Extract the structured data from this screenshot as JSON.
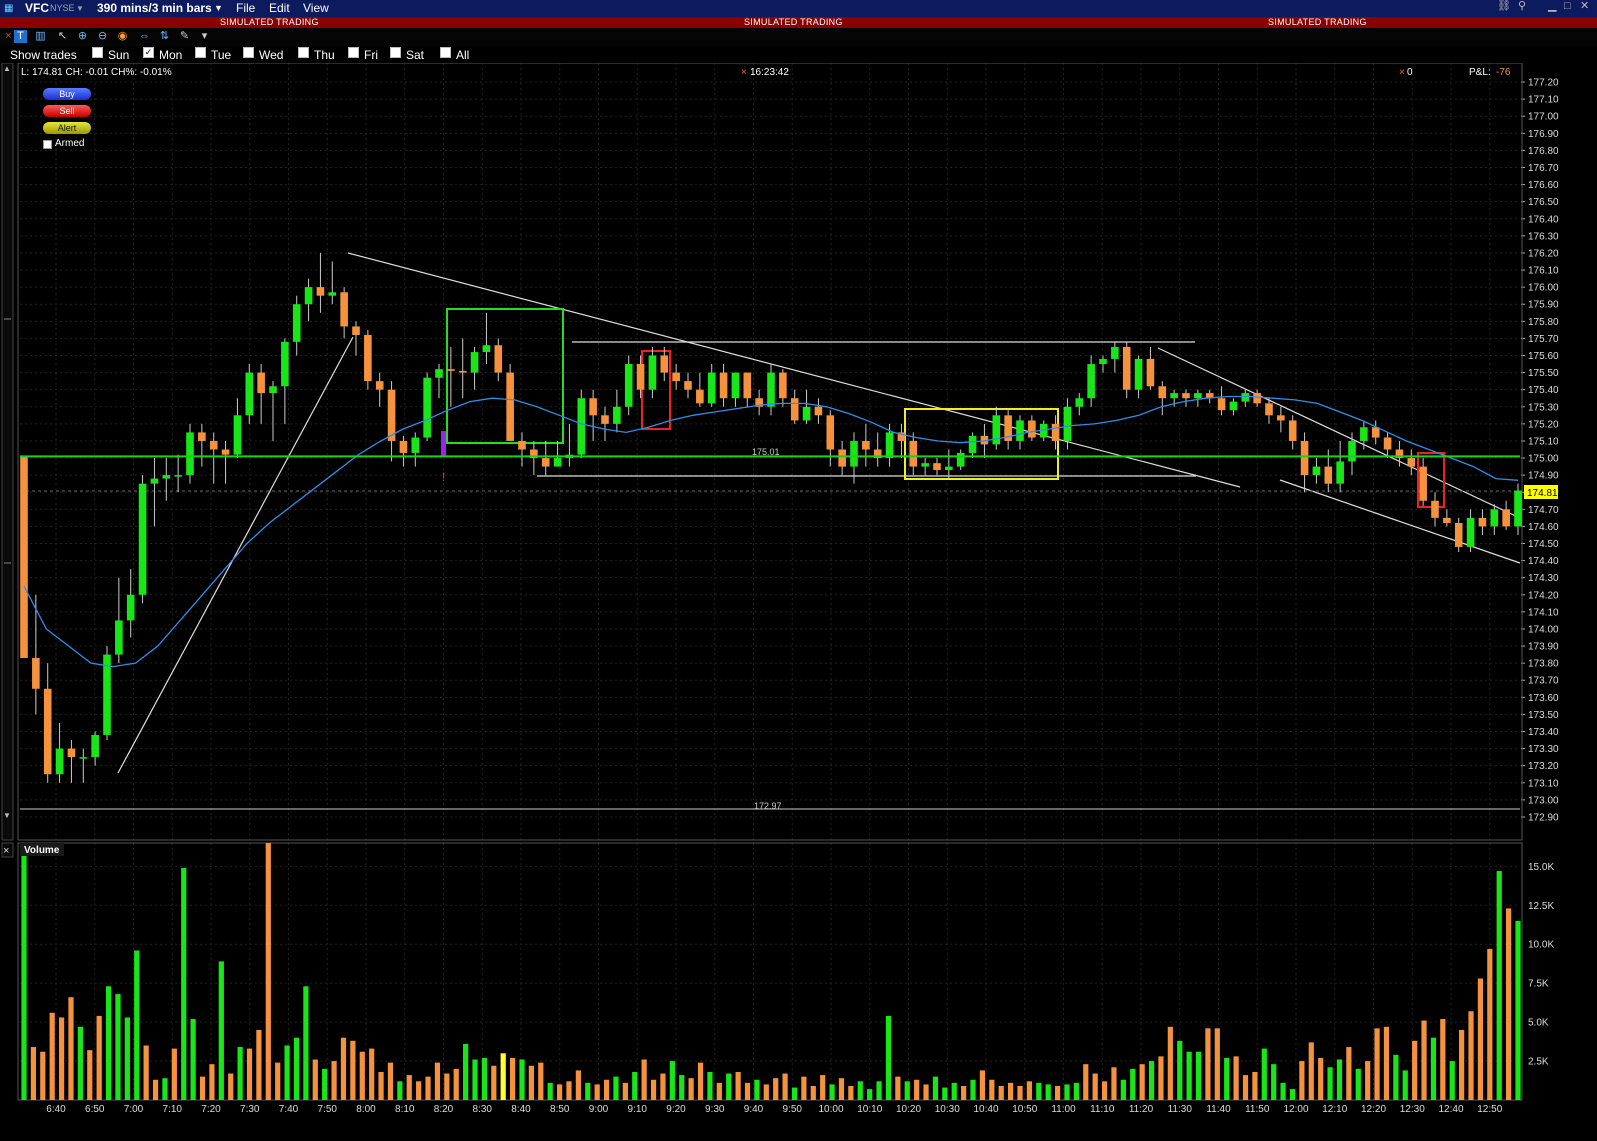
{
  "menubar": {
    "symbol": "VFC",
    "exchange": "NYSE",
    "timeframe": "390 mins/3 min bars",
    "menu_file": "File",
    "menu_edit": "Edit",
    "menu_view": "View"
  },
  "banner": {
    "text_left": "SIMULATED TRADING",
    "text_center": "SIMULATED TRADING",
    "text_right": "SIMULATED TRADING"
  },
  "days": {
    "show_trades": "Show trades",
    "items": [
      {
        "label": "Sun",
        "checked": false
      },
      {
        "label": "Mon",
        "checked": true
      },
      {
        "label": "Tue",
        "checked": false
      },
      {
        "label": "Wed",
        "checked": false
      },
      {
        "label": "Thu",
        "checked": false
      },
      {
        "label": "Fri",
        "checked": false
      },
      {
        "label": "Sat",
        "checked": false
      },
      {
        "label": "All",
        "checked": false
      }
    ]
  },
  "info": {
    "stats": "L: 174.81  CH: -0.01  CH%: -0.01%",
    "time": "16:23:42",
    "position": "0",
    "pnl_label": "P&L:",
    "pnl_value": "-76"
  },
  "order_buttons": {
    "buy": "Buy",
    "sell": "Sell",
    "alert": "Alert",
    "armed": "Armed"
  },
  "price_labels": {
    "last": "174.81",
    "level_line": "175.01",
    "low_label": "172.97"
  },
  "volume_title": "Volume",
  "colors": {
    "up": "#19e619",
    "down": "#f5923e",
    "doji": "#ffff33",
    "ema": "#2f8fe8",
    "level": "#19d219"
  },
  "chart_data": [
    {
      "type": "candlestick",
      "ylim": [
        172.85,
        177.25
      ],
      "yticks": [
        "177.20",
        "177.10",
        "177.00",
        "176.90",
        "176.80",
        "176.70",
        "176.60",
        "176.50",
        "176.40",
        "176.30",
        "176.20",
        "176.10",
        "176.00",
        "175.90",
        "175.80",
        "175.70",
        "175.60",
        "175.50",
        "175.40",
        "175.30",
        "175.20",
        "175.10",
        "175.00",
        "174.90",
        "174.80",
        "174.70",
        "174.60",
        "174.50",
        "174.40",
        "174.30",
        "174.20",
        "174.10",
        "174.00",
        "173.90",
        "173.80",
        "173.70",
        "173.60",
        "173.50",
        "173.40",
        "173.30",
        "173.20",
        "173.10",
        "173.00",
        "172.90"
      ],
      "xticks": [
        "6:40",
        "6:50",
        "7:00",
        "7:10",
        "7:20",
        "7:30",
        "7:40",
        "7:50",
        "8:00",
        "8:10",
        "8:20",
        "8:30",
        "8:40",
        "8:50",
        "9:00",
        "9:10",
        "9:20",
        "9:30",
        "9:40",
        "9:50",
        "10:00",
        "10:10",
        "10:20",
        "10:30",
        "10:40",
        "10:50",
        "11:00",
        "11:10",
        "11:20",
        "11:30",
        "11:40",
        "11:50",
        "12:00",
        "12:10",
        "12:20",
        "12:30",
        "12:40",
        "12:50"
      ],
      "candles": [
        [
          175.01,
          175.01,
          173.83,
          173.83
        ],
        [
          173.83,
          174.2,
          173.5,
          173.65
        ],
        [
          173.65,
          173.8,
          173.1,
          173.15
        ],
        [
          173.15,
          173.45,
          173.1,
          173.3
        ],
        [
          173.3,
          173.35,
          173.1,
          173.25
        ],
        [
          173.25,
          173.3,
          173.1,
          173.25
        ],
        [
          173.25,
          173.4,
          173.2,
          173.38
        ],
        [
          173.38,
          173.9,
          173.35,
          173.85
        ],
        [
          173.85,
          174.3,
          173.8,
          174.05
        ],
        [
          174.05,
          174.35,
          173.95,
          174.2
        ],
        [
          174.2,
          174.9,
          174.15,
          174.85
        ],
        [
          174.85,
          175.0,
          174.6,
          174.88
        ],
        [
          174.88,
          175.0,
          174.75,
          174.9
        ],
        [
          174.9,
          175.02,
          174.8,
          174.9
        ],
        [
          174.9,
          175.2,
          174.85,
          175.15
        ],
        [
          175.15,
          175.2,
          174.95,
          175.1
        ],
        [
          175.1,
          175.15,
          174.85,
          175.05
        ],
        [
          175.05,
          175.1,
          174.85,
          175.02
        ],
        [
          175.02,
          175.35,
          175.0,
          175.25
        ],
        [
          175.25,
          175.55,
          175.2,
          175.5
        ],
        [
          175.5,
          175.55,
          175.2,
          175.38
        ],
        [
          175.38,
          175.45,
          175.1,
          175.42
        ],
        [
          175.42,
          175.7,
          175.2,
          175.68
        ],
        [
          175.68,
          175.95,
          175.6,
          175.9
        ],
        [
          175.9,
          176.05,
          175.8,
          176.0
        ],
        [
          176.0,
          176.2,
          175.85,
          175.95
        ],
        [
          175.95,
          176.15,
          175.9,
          175.97
        ],
        [
          175.97,
          176.0,
          175.7,
          175.77
        ],
        [
          175.77,
          175.8,
          175.6,
          175.72
        ],
        [
          175.72,
          175.75,
          175.4,
          175.45
        ],
        [
          175.45,
          175.5,
          175.3,
          175.4
        ],
        [
          175.4,
          175.45,
          174.98,
          175.1
        ],
        [
          175.1,
          175.13,
          174.95,
          175.03
        ],
        [
          175.03,
          175.15,
          174.95,
          175.12
        ],
        [
          175.12,
          175.5,
          175.1,
          175.47
        ],
        [
          175.47,
          175.55,
          175.35,
          175.52
        ],
        [
          175.52,
          175.65,
          175.3,
          175.51
        ],
        [
          175.51,
          175.7,
          175.35,
          175.5
        ],
        [
          175.5,
          175.65,
          175.4,
          175.62
        ],
        [
          175.62,
          175.85,
          175.55,
          175.66
        ],
        [
          175.66,
          175.7,
          175.45,
          175.5
        ],
        [
          175.5,
          175.55,
          175.2,
          175.1
        ],
        [
          175.1,
          175.15,
          174.95,
          175.05
        ],
        [
          175.05,
          175.1,
          174.9,
          175.0
        ],
        [
          175.0,
          175.1,
          174.9,
          174.95
        ],
        [
          174.95,
          175.1,
          174.95,
          175.0
        ],
        [
          175.0,
          175.2,
          174.95,
          175.02
        ],
        [
          175.02,
          175.4,
          175.0,
          175.35
        ],
        [
          175.35,
          175.4,
          175.1,
          175.25
        ],
        [
          175.25,
          175.3,
          175.1,
          175.2
        ],
        [
          175.2,
          175.4,
          175.15,
          175.3
        ],
        [
          175.3,
          175.6,
          175.25,
          175.55
        ],
        [
          175.55,
          175.6,
          175.35,
          175.4
        ],
        [
          175.4,
          175.65,
          175.35,
          175.6
        ],
        [
          175.6,
          175.65,
          175.45,
          175.5
        ],
        [
          175.5,
          175.55,
          175.4,
          175.45
        ],
        [
          175.45,
          175.5,
          175.35,
          175.4
        ],
        [
          175.4,
          175.5,
          175.3,
          175.32
        ],
        [
          175.32,
          175.55,
          175.3,
          175.5
        ],
        [
          175.5,
          175.55,
          175.3,
          175.35
        ],
        [
          175.35,
          175.5,
          175.3,
          175.5
        ],
        [
          175.5,
          175.5,
          175.3,
          175.35
        ],
        [
          175.35,
          175.4,
          175.25,
          175.3
        ],
        [
          175.3,
          175.55,
          175.25,
          175.5
        ],
        [
          175.5,
          175.52,
          175.3,
          175.35
        ],
        [
          175.35,
          175.4,
          175.2,
          175.22
        ],
        [
          175.22,
          175.4,
          175.2,
          175.3
        ],
        [
          175.3,
          175.35,
          175.2,
          175.25
        ],
        [
          175.25,
          175.28,
          174.95,
          175.05
        ],
        [
          175.05,
          175.1,
          174.9,
          174.95
        ],
        [
          174.95,
          175.15,
          174.85,
          175.1
        ],
        [
          175.1,
          175.2,
          174.95,
          175.05
        ],
        [
          175.05,
          175.15,
          174.95,
          175.0
        ],
        [
          175.0,
          175.2,
          174.95,
          175.15
        ],
        [
          175.15,
          175.2,
          175.0,
          175.1
        ],
        [
          175.1,
          175.15,
          174.9,
          174.95
        ],
        [
          174.95,
          175.0,
          174.9,
          174.97
        ],
        [
          174.97,
          175.0,
          174.9,
          174.93
        ],
        [
          174.93,
          175.05,
          174.88,
          174.95
        ],
        [
          174.95,
          175.05,
          174.93,
          175.03
        ],
        [
          175.03,
          175.15,
          175.0,
          175.13
        ],
        [
          175.13,
          175.2,
          175.0,
          175.08
        ],
        [
          175.08,
          175.3,
          175.05,
          175.25
        ],
        [
          175.25,
          175.28,
          175.05,
          175.1
        ],
        [
          175.1,
          175.25,
          175.05,
          175.22
        ],
        [
          175.22,
          175.25,
          175.1,
          175.12
        ],
        [
          175.12,
          175.22,
          175.1,
          175.2
        ],
        [
          175.2,
          175.25,
          175.05,
          175.1
        ],
        [
          175.1,
          175.35,
          175.05,
          175.3
        ],
        [
          175.3,
          175.38,
          175.25,
          175.35
        ],
        [
          175.35,
          175.6,
          175.3,
          175.55
        ],
        [
          175.55,
          175.6,
          175.5,
          175.58
        ],
        [
          175.58,
          175.68,
          175.5,
          175.65
        ],
        [
          175.65,
          175.68,
          175.35,
          175.4
        ],
        [
          175.4,
          175.6,
          175.35,
          175.58
        ],
        [
          175.58,
          175.65,
          175.4,
          175.42
        ],
        [
          175.42,
          175.45,
          175.25,
          175.35
        ],
        [
          175.35,
          175.4,
          175.3,
          175.38
        ],
        [
          175.38,
          175.4,
          175.3,
          175.35
        ],
        [
          175.35,
          175.4,
          175.3,
          175.38
        ],
        [
          175.38,
          175.4,
          175.32,
          175.35
        ],
        [
          175.35,
          175.42,
          175.25,
          175.28
        ],
        [
          175.28,
          175.35,
          175.25,
          175.33
        ],
        [
          175.33,
          175.4,
          175.3,
          175.38
        ],
        [
          175.38,
          175.4,
          175.3,
          175.32
        ],
        [
          175.32,
          175.35,
          175.2,
          175.25
        ],
        [
          175.25,
          175.3,
          175.15,
          175.22
        ],
        [
          175.22,
          175.25,
          175.05,
          175.1
        ],
        [
          175.1,
          175.15,
          174.8,
          174.9
        ],
        [
          174.9,
          175.0,
          174.85,
          174.95
        ],
        [
          174.95,
          175.05,
          174.8,
          174.85
        ],
        [
          174.85,
          175.1,
          174.8,
          174.98
        ],
        [
          174.98,
          175.15,
          174.9,
          175.1
        ],
        [
          175.1,
          175.22,
          175.05,
          175.18
        ],
        [
          175.18,
          175.22,
          175.08,
          175.12
        ],
        [
          175.12,
          175.15,
          175.0,
          175.05
        ],
        [
          175.05,
          175.1,
          174.95,
          175.0
        ],
        [
          175.0,
          175.05,
          174.9,
          174.95
        ],
        [
          174.95,
          175.0,
          174.72,
          174.75
        ],
        [
          174.75,
          174.8,
          174.6,
          174.65
        ],
        [
          174.65,
          174.7,
          174.6,
          174.62
        ],
        [
          174.62,
          174.65,
          174.45,
          174.48
        ],
        [
          174.48,
          174.7,
          174.45,
          174.65
        ],
        [
          174.65,
          174.7,
          174.55,
          174.6
        ],
        [
          174.6,
          174.73,
          174.55,
          174.7
        ],
        [
          174.7,
          174.75,
          174.58,
          174.6
        ],
        [
          174.6,
          174.85,
          174.55,
          174.81
        ]
      ],
      "ema": [
        174.25,
        174.0,
        173.9,
        173.8,
        173.78,
        173.8,
        173.9,
        174.05,
        174.2,
        174.35,
        174.5,
        174.62,
        174.72,
        174.82,
        174.92,
        175.02,
        175.1,
        175.17,
        175.22,
        175.28,
        175.33,
        175.35,
        175.34,
        175.3,
        175.25,
        175.2,
        175.17,
        175.15,
        175.18,
        175.22,
        175.25,
        175.27,
        175.29,
        175.31,
        175.32,
        175.32,
        175.3,
        175.26,
        175.21,
        175.15,
        175.12,
        175.1,
        175.09,
        175.1,
        175.12,
        175.15,
        175.17,
        175.19,
        175.2,
        175.22,
        175.25,
        175.3,
        175.33,
        175.35,
        175.36,
        175.36,
        175.35,
        175.34,
        175.32,
        175.27,
        175.22,
        175.16,
        175.1,
        175.05,
        175.0,
        174.95,
        174.88,
        174.87
      ],
      "level_line": 175.01
    },
    {
      "type": "bar",
      "title": "Volume",
      "ylim": [
        0,
        16500
      ],
      "yticks": [
        "15.0K",
        "12.5K",
        "10.0K",
        "7.5K",
        "5.0K",
        "2.5K"
      ],
      "values": [
        16300,
        3400,
        3100,
        5600,
        5300,
        6600,
        4700,
        3200,
        5400,
        7300,
        6800,
        5300,
        9600,
        3500,
        1300,
        1400,
        3300,
        14900,
        5200,
        1500,
        2300,
        8900,
        1700,
        3400,
        3300,
        4500,
        16500,
        2400,
        3500,
        4000,
        7300,
        2600,
        2000,
        2500,
        4000,
        3800,
        3100,
        3300,
        1800,
        2400,
        1200,
        1600,
        1200,
        1500,
        2400,
        1700,
        2000,
        3600,
        2600,
        2700,
        2200,
        3000,
        2700,
        2600,
        2200,
        2400,
        1100,
        1000,
        1200,
        1900,
        1100,
        1000,
        1300,
        1500,
        1100,
        1800,
        2600,
        1300,
        1700,
        2500,
        1600,
        1400,
        2400,
        1800,
        1100,
        1700,
        1800,
        1100,
        1300,
        1000,
        1400,
        1700,
        800,
        1500,
        900,
        1600,
        1000,
        1400,
        900,
        1200,
        700,
        1200,
        5400,
        1500,
        1200,
        1300,
        1000,
        1500,
        800,
        1100,
        900,
        1300,
        1900,
        1300,
        900,
        1100,
        900,
        1200,
        1100,
        1000,
        900,
        1000,
        1100,
        2300,
        1700,
        1200,
        2100,
        1300,
        2000,
        2300,
        2500,
        2800,
        4700,
        3800,
        3100,
        3100,
        4600,
        4600,
        2700,
        2800,
        1600,
        1800,
        3300,
        2300,
        1100,
        700,
        2500,
        3700,
        2700,
        2100,
        2600,
        3400,
        2000,
        2500,
        4600,
        4700,
        2900,
        1900,
        3800,
        5100,
        4000,
        5200,
        2500,
        4500,
        5700,
        7800,
        9700,
        14700,
        12300,
        11500
      ],
      "up": [
        1,
        0,
        0,
        0,
        0,
        0,
        1,
        0,
        0,
        1,
        1,
        1,
        1,
        0,
        0,
        1,
        0,
        1,
        1,
        0,
        0,
        1,
        0,
        1,
        0,
        0,
        0,
        0,
        1,
        1,
        1,
        0,
        1,
        0,
        0,
        0,
        0,
        0,
        0,
        0,
        1,
        0,
        0,
        0,
        0,
        0,
        0,
        1,
        1,
        1,
        0,
        0,
        0,
        1,
        0,
        0,
        1,
        0,
        0,
        0,
        1,
        0,
        0,
        1,
        0,
        1,
        0,
        0,
        0,
        1,
        1,
        0,
        0,
        1,
        0,
        1,
        0,
        0,
        1,
        0,
        0,
        0,
        1,
        0,
        0,
        0,
        1,
        0,
        0,
        1,
        1,
        1,
        1,
        0,
        1,
        0,
        0,
        1,
        1,
        1,
        0,
        1,
        0,
        0,
        0,
        0,
        0,
        0,
        1,
        1,
        0,
        1,
        1,
        0,
        0,
        0,
        0,
        1,
        1,
        0,
        1,
        0,
        0,
        1,
        1,
        1,
        0,
        0,
        1,
        0,
        0,
        0,
        1,
        1,
        1,
        1,
        0,
        0,
        0,
        1,
        1,
        0,
        1,
        0,
        0,
        0,
        1,
        1,
        0,
        0,
        1,
        0,
        1,
        0,
        0,
        0,
        0,
        1,
        0,
        1,
        0,
        1,
        1
      ]
    }
  ]
}
